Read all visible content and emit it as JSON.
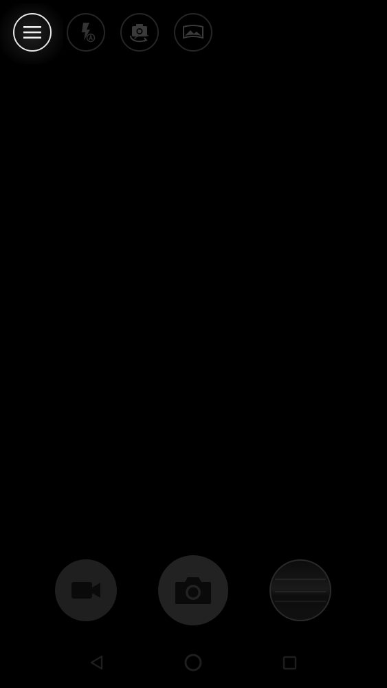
{
  "top_bar": {
    "buttons": [
      {
        "icon": "menu-icon"
      },
      {
        "icon": "flash-auto-icon"
      },
      {
        "icon": "switch-camera-icon"
      },
      {
        "icon": "panorama-mode-icon"
      }
    ]
  },
  "bottom_controls": {
    "video_icon": "videocam-icon",
    "shutter_icon": "camera-icon",
    "last_photo_icon": "photo-thumbnail"
  },
  "nav_bar": {
    "back_icon": "back-triangle-icon",
    "home_icon": "home-circle-icon",
    "recents_icon": "recents-square-icon"
  },
  "colors": {
    "background": "#000000",
    "active_outline": "#e8e8e8",
    "inactive_outline": "#262626",
    "button_fill": "#1f1f1f",
    "icon_dim": "#3a3a3a"
  }
}
